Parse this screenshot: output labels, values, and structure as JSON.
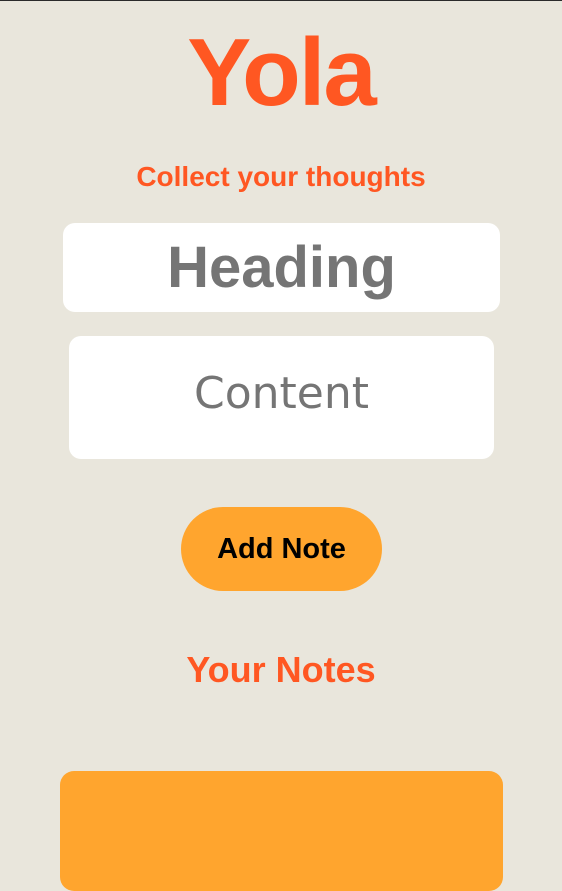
{
  "app": {
    "title": "Yola",
    "tagline": "Collect your thoughts"
  },
  "form": {
    "heading_placeholder": "Heading",
    "heading_value": "",
    "content_placeholder": "Content",
    "content_value": "",
    "add_button_label": "Add Note"
  },
  "notes": {
    "section_title": "Your Notes"
  },
  "colors": {
    "background": "#e9e6dc",
    "accent": "#ff5722",
    "button": "#ffa52e",
    "placeholder_text": "#757575",
    "input_background": "#ffffff"
  }
}
